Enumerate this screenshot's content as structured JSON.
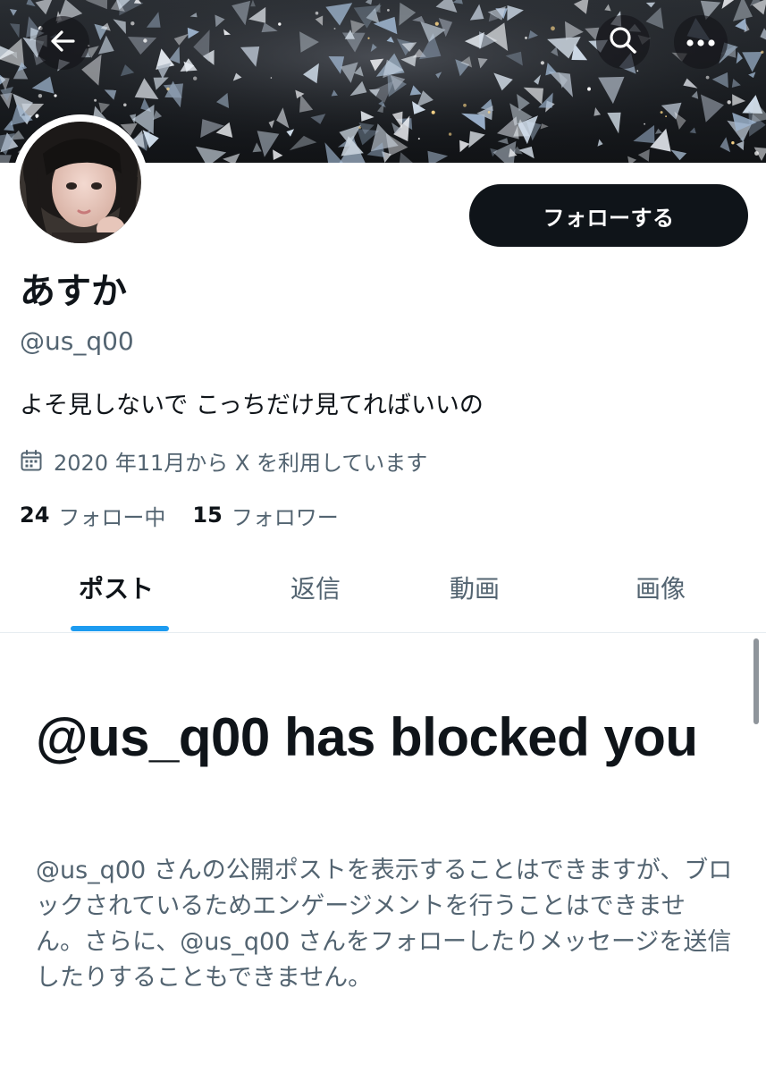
{
  "header": {
    "back_icon": "arrow-left-icon",
    "search_icon": "search-icon",
    "more_icon": "more-horizontal-icon"
  },
  "profile": {
    "follow_label": "フォローする",
    "display_name": "あすか",
    "handle": "@us_q00",
    "bio": "よそ見しないで こっちだけ見てればいいの",
    "joined": "2020 年11月から X を利用しています",
    "following_count": "24",
    "following_label": "フォロー中",
    "followers_count": "15",
    "followers_label": "フォロワー"
  },
  "tabs": [
    {
      "label": "ポスト",
      "active": true
    },
    {
      "label": "返信",
      "active": false
    },
    {
      "label": "動画",
      "active": false
    },
    {
      "label": "画像",
      "active": false
    }
  ],
  "blocked": {
    "title": "@us_q00 has blocked you",
    "body": "@us_q00 さんの公開ポストを表示することはできますが、ブロックされているためエンゲージメントを行うことはできません。さらに、@us_q00 さんをフォローしたりメッセージを送信したりすることもできません。"
  },
  "colors": {
    "accent": "#1d9bf0",
    "text_primary": "#0f1419",
    "text_secondary": "#536471",
    "button_bg": "#0f1419"
  }
}
